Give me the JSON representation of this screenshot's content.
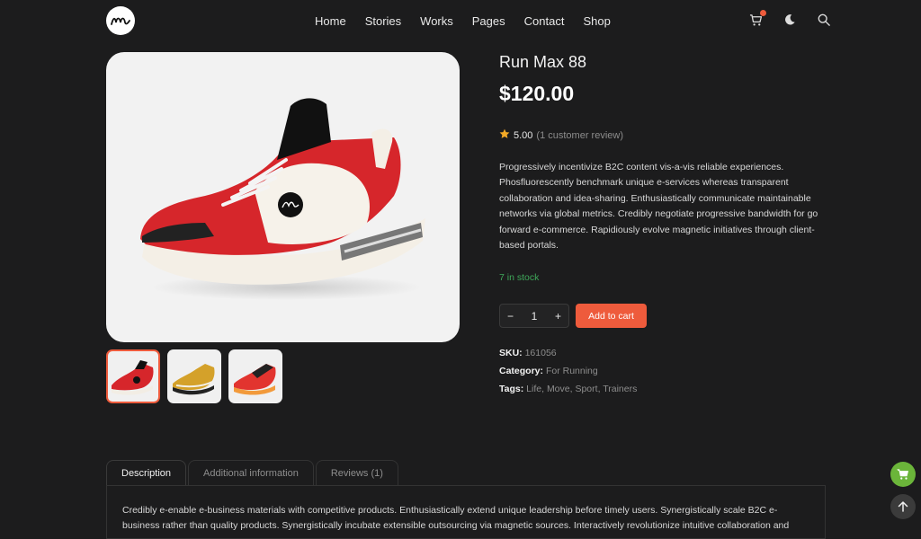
{
  "header": {
    "nav": [
      "Home",
      "Stories",
      "Works",
      "Pages",
      "Contact",
      "Shop"
    ],
    "icons": [
      "cart-icon",
      "moon-icon",
      "search-icon"
    ],
    "cart_badge_color": "#ee5b3c"
  },
  "product": {
    "title": "Run Max 88",
    "price": "$120.00",
    "rating": "5.00",
    "rating_stars": 5,
    "reviews": "(1 customer review)",
    "description": "Progressively incentivize B2C content vis-a-vis reliable experiences. Phosfluorescently benchmark unique e-services whereas transparent collaboration and idea-sharing. Enthusiastically communicate maintainable networks via global metrics. Credibly negotiate progressive bandwidth for go forward e-commerce. Rapidiously evolve magnetic initiatives through client-based portals.",
    "stock": "7 in stock",
    "quantity": "1",
    "qty_minus": "−",
    "qty_plus": "+",
    "add_to_cart": "Add to cart",
    "sku_label": "SKU:",
    "sku": "161056",
    "category_label": "Category:",
    "category": "For Running",
    "tags_label": "Tags:",
    "tags": [
      "Life",
      "Move",
      "Sport",
      "Trainers"
    ],
    "thumbnails": [
      "red-shoe",
      "yellow-shoe",
      "orange-shoe"
    ]
  },
  "tabs": {
    "items": [
      "Description",
      "Additional information",
      "Reviews (1)"
    ],
    "active": "Description",
    "description_text": "Credibly e-enable e-business materials with competitive products. Enthusiastically extend unique leadership before timely users. Synergistically scale B2C e-business rather than quality products. Synergistically incubate extensible outsourcing via magnetic sources. Interactively revolutionize intuitive collaboration and"
  },
  "colors": {
    "background": "#1c1c1d",
    "accent": "#ee5b3c",
    "stock": "#3fa85a",
    "cart_fab": "#6bb53a"
  }
}
